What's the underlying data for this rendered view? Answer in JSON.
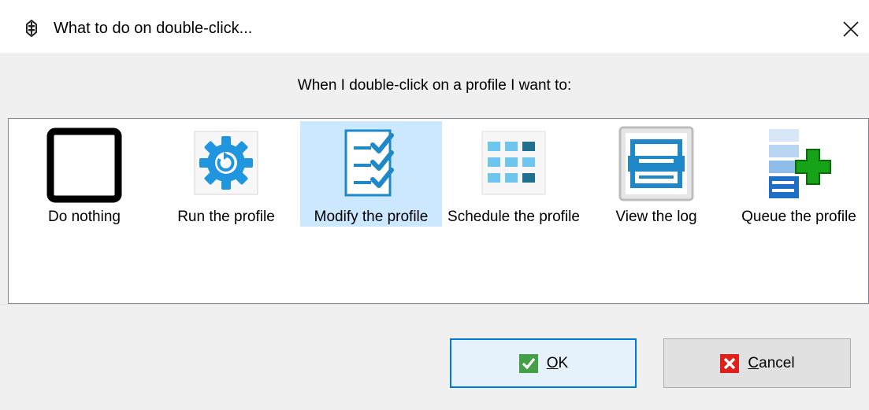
{
  "window": {
    "title": "What to do on double-click...",
    "app_icon": "app-icon",
    "close_icon": "close-icon"
  },
  "prompt": "When I double-click on a profile I want to:",
  "options": [
    {
      "label": "Do nothing",
      "icon": "empty-square-icon",
      "selected": false
    },
    {
      "label": "Run the profile",
      "icon": "gear-refresh-icon",
      "selected": false
    },
    {
      "label": "Modify the profile",
      "icon": "checklist-icon",
      "selected": true
    },
    {
      "label": "Schedule the profile",
      "icon": "calendar-grid-icon",
      "selected": false
    },
    {
      "label": "View the log",
      "icon": "log-viewer-icon",
      "selected": false
    },
    {
      "label": "Queue the profile",
      "icon": "queue-add-icon",
      "selected": false
    }
  ],
  "buttons": {
    "ok": {
      "accel": "O",
      "rest": "K",
      "icon": "check-icon"
    },
    "cancel": {
      "accel": "C",
      "rest": "ancel",
      "icon": "x-icon"
    }
  },
  "colors": {
    "selection": "#cce8ff",
    "accent_blue": "#1e88c8",
    "ok_green": "#43a047",
    "cancel_red": "#e0201b",
    "queue_green": "#17a317"
  }
}
